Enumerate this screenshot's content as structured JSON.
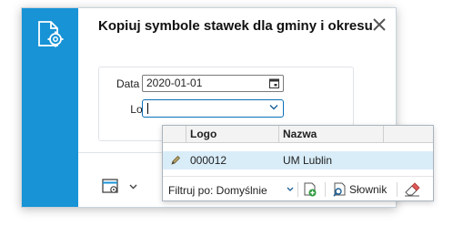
{
  "dialog": {
    "title": "Kopiuj symbole stawek dla gminy i okresu",
    "close_icon": "close-icon",
    "side_icon": "document-settings-icon"
  },
  "form": {
    "date_from": {
      "label": "Data od",
      "value": "2020-01-01",
      "icon": "calendar-icon"
    },
    "logo": {
      "label": "Logo",
      "value": "",
      "icon": "chevron-down-icon"
    }
  },
  "footer": {
    "settings_icon": "window-settings-icon",
    "menu_icon": "chevron-down-icon"
  },
  "dropdown": {
    "columns": [
      "Logo",
      "Nazwa"
    ],
    "rows": [
      {
        "icon": "pencil-icon",
        "logo": "000012",
        "nazwa": "UM Lublin"
      }
    ],
    "filter_label": "Filtruj po: Domyślnie",
    "dictionary_label": "Słownik",
    "add_icon": "add-document-icon",
    "search_icon": "search-document-icon",
    "eraser_icon": "eraser-icon"
  },
  "colors": {
    "accent": "#1793d6",
    "selected_row": "#d9edf8",
    "input_focus": "#0b6fb8"
  }
}
